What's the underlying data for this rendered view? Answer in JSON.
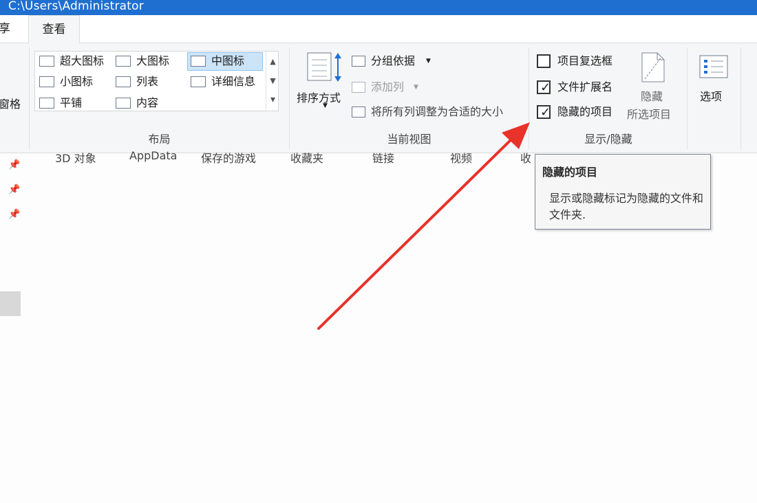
{
  "titlebar": {
    "path": "C:\\Users\\Administrator"
  },
  "tabs": {
    "share": "享",
    "view": "查看"
  },
  "pane": {
    "label": "窗格"
  },
  "layout": {
    "items": [
      "超大图标",
      "大图标",
      "中图标",
      "小图标",
      "列表",
      "详细信息",
      "平铺",
      "内容"
    ],
    "group_label": "布局",
    "scroll_up": "▲",
    "scroll_down": "▼",
    "scroll_more": "▾"
  },
  "current_view": {
    "sort_by": "排序方式",
    "group_by": "分组依据",
    "add_column": "添加列",
    "size_columns": "将所有列调整为合适的大小",
    "group_label": "当前视图"
  },
  "show_hide": {
    "item_checkboxes": {
      "label": "项目复选框",
      "checked": false
    },
    "file_extensions": {
      "label": "文件扩展名",
      "checked": true
    },
    "hidden_items": {
      "label": "隐藏的项目",
      "checked": true
    },
    "hide_selected_line1": "隐藏",
    "hide_selected_line2": "所选项目",
    "group_label": "显示/隐藏"
  },
  "options": {
    "label": "选项"
  },
  "file_list": {
    "columns": [
      "3D 对象",
      "AppData",
      "保存的游戏",
      "收藏夹",
      "链接",
      "视频",
      "收"
    ]
  },
  "tooltip": {
    "title": "隐藏的项目",
    "description": "显示或隐藏标记为隐藏的文件和文件夹."
  },
  "colors": {
    "titlebar": "#1f6fd1",
    "arrow": "#e8322a",
    "selection": "#cce4f7"
  },
  "icons": {
    "pin": "pin-icon",
    "dropdown": "chevron-down-icon"
  }
}
